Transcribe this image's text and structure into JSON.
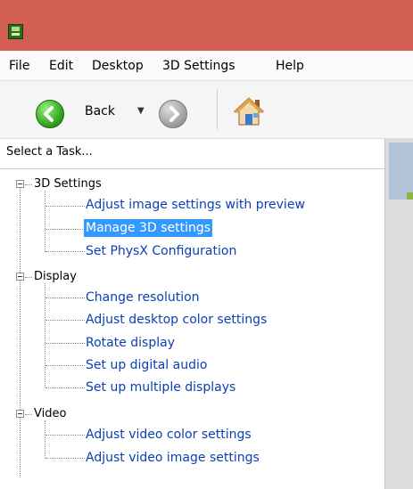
{
  "menu": [
    "File",
    "Edit",
    "Desktop",
    "3D Settings",
    "Help"
  ],
  "toolbar": {
    "back_label": "Back"
  },
  "tasks": {
    "header": "Select a Task...",
    "groups": [
      {
        "label": "3D Settings",
        "items": [
          "Adjust image settings with preview",
          "Manage 3D settings",
          "Set PhysX Configuration"
        ]
      },
      {
        "label": "Display",
        "items": [
          "Change resolution",
          "Adjust desktop color settings",
          "Rotate display",
          "Set up digital audio",
          "Set up multiple displays"
        ]
      },
      {
        "label": "Video",
        "items": [
          "Adjust video color settings",
          "Adjust video image settings"
        ]
      }
    ],
    "selected": "Manage 3D settings"
  }
}
